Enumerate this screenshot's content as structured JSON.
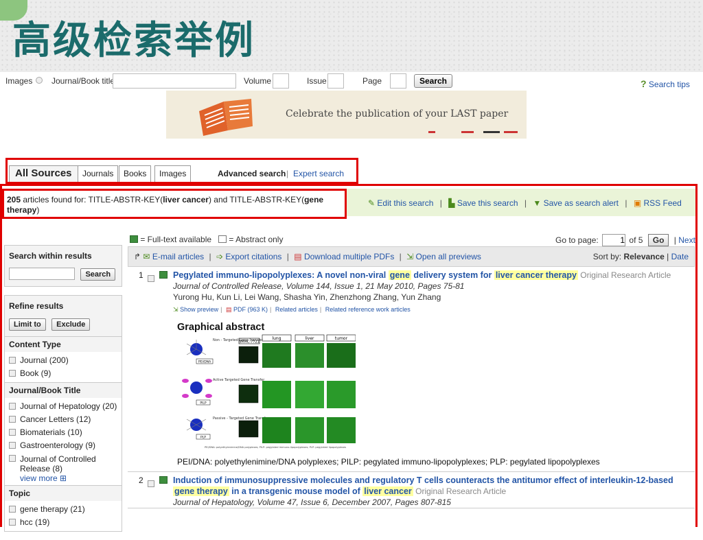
{
  "slide": {
    "title": "高级检索举例"
  },
  "search_bar": {
    "images_label": "Images",
    "journal_label": "Journal/Book title",
    "volume_label": "Volume",
    "issue_label": "Issue",
    "page_label": "Page",
    "search_button": "Search",
    "search_tips": "Search tips"
  },
  "banner": {
    "text": "Celebrate the publication of your LAST paper"
  },
  "tabs": {
    "items": [
      "All Sources",
      "Journals",
      "Books",
      "Images"
    ],
    "advanced_search": "Advanced search",
    "separator": "|",
    "expert_search": "Expert search"
  },
  "results_header": {
    "count": "205",
    "found_prefix": "articles found for: TITLE-ABSTR-KEY(",
    "term1": "liver cancer",
    "mid": ") and TITLE-ABSTR-KEY(",
    "term2": "gene therapy",
    "suffix": ")",
    "edit_search": "Edit this search",
    "save_search": "Save this search",
    "save_alert": "Save as search alert",
    "rss": "RSS Feed"
  },
  "legend": {
    "full_text": "= Full-text available",
    "abstract": "= Abstract only"
  },
  "pagination": {
    "goto_label": "Go to page:",
    "current_page": "1",
    "of_label": "of 5",
    "go_button": "Go",
    "next": "Next"
  },
  "sidebar": {
    "search_within_title": "Search within results",
    "search_button": "Search",
    "refine_title": "Refine results",
    "limit_button": "Limit to",
    "exclude_button": "Exclude",
    "facets": [
      {
        "title": "Content Type",
        "items": [
          "Journal (200)",
          "Book (9)"
        ]
      },
      {
        "title": "Journal/Book Title",
        "items": [
          "Journal of Hepatology (20)",
          "Cancer Letters (12)",
          "Biomaterials (10)",
          "Gastroenterology (9)",
          "Journal of Controlled Release (8)"
        ],
        "more": "view more"
      },
      {
        "title": "Topic",
        "items": [
          "gene therapy (21)",
          "hcc (19)"
        ]
      }
    ]
  },
  "actions": {
    "email": "E-mail articles",
    "export": "Export citations",
    "download": "Download multiple PDFs",
    "previews": "Open all previews",
    "sort_label": "Sort by:",
    "sort_relevance": "Relevance",
    "sort_date": "Date"
  },
  "results": [
    {
      "num": "1",
      "title_a": "Pegylated immuno-lipopolyplexes: A novel non-viral ",
      "title_hl1": "gene",
      "title_b": " delivery system for ",
      "title_hl2": "liver cancer therapy",
      "type": "Original Research Article",
      "journal": "Journal of Controlled Release, Volume 144, Issue 1, 21 May 2010, Pages 75-81",
      "authors": "Yurong Hu, Kun Li, Lei Wang, Shasha Yin, Zhenzhong Zhang, Yun Zhang",
      "links": [
        "Show preview",
        "PDF (963 K)",
        "Related articles",
        "Related reference work articles"
      ],
      "ga_title": "Graphical abstract",
      "ga_caption": "PEI/DNA: polyethylenimine/DNA polyplexes; PILP: pegylated immuno-lipopolyplexes; PLP: pegylated lipopolyplexes",
      "figure": {
        "col_labels": [
          "SMMC-7721",
          "lung",
          "liver",
          "tumor"
        ],
        "row_labels": [
          "Non - Targeted Gene Transfer",
          "Active Targeted Gene Transfer",
          "Passive - Targeted Gene Transfer"
        ],
        "vector_labels": [
          "PEI/DNA",
          "PILP",
          "PLP"
        ],
        "footnote": "PEI/DNA: polyethylenimine/DNA polyplexes; PILP: pegylated immuno-lipopolyplexes; PLP: pegylated lipopolyplexes"
      }
    },
    {
      "num": "2",
      "title_a": "Induction of immunosuppressive molecules and regulatory T cells counteracts the antitumor effect of interleukin-12-based ",
      "title_hl1": "gene therapy",
      "title_b": " in a transgenic mouse model of ",
      "title_hl2": "liver cancer",
      "type": "Original Research Article",
      "journal": "Journal of Hepatology, Volume 47, Issue 6, December 2007, Pages 807-815"
    }
  ],
  "colors": {
    "accent_red": "#e00000",
    "link_blue": "#2254a6",
    "title_teal": "#1b6b6b",
    "highlight": "#ffffa0",
    "toolbar_green": "#eaf4d8"
  }
}
